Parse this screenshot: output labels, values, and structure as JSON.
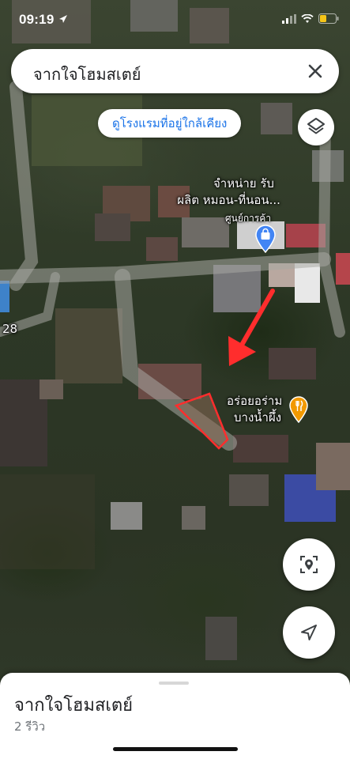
{
  "status_bar": {
    "time": "09:19",
    "icons": [
      "location-arrow-icon",
      "signal-icon",
      "wifi-icon",
      "battery-icon"
    ],
    "battery_color": "#f5c518"
  },
  "search": {
    "query": "จากใจโฮมสเตย์",
    "close_icon": "close-icon"
  },
  "chip": {
    "label": "ดูโรงแรมที่อยู่ใกล้เคียง"
  },
  "layers_button": {
    "icon": "layers-icon"
  },
  "map": {
    "poi_store": {
      "name_line1": "จำหน่าย รับ",
      "name_line2": "ผลิต หมอน-ที่นอน...",
      "category": "ศูนย์การค้า",
      "icon": "shopping-bag-icon",
      "pin_color": "#4285f4"
    },
    "poi_restaurant": {
      "name_line1": "อร่อยอร่าม",
      "name_line2": "บางน้ำผึ้ง",
      "icon": "restaurant-icon",
      "pin_color": "#f29900"
    },
    "road_label": "28",
    "annotation_color": "#ff2d2d"
  },
  "buttons": {
    "recenter_icon": "crosshair-location-icon",
    "navigate_icon": "navigation-arrow-icon"
  },
  "sheet": {
    "title": "จากใจโฮมสเตย์",
    "subtitle": "2 รีวิว"
  }
}
